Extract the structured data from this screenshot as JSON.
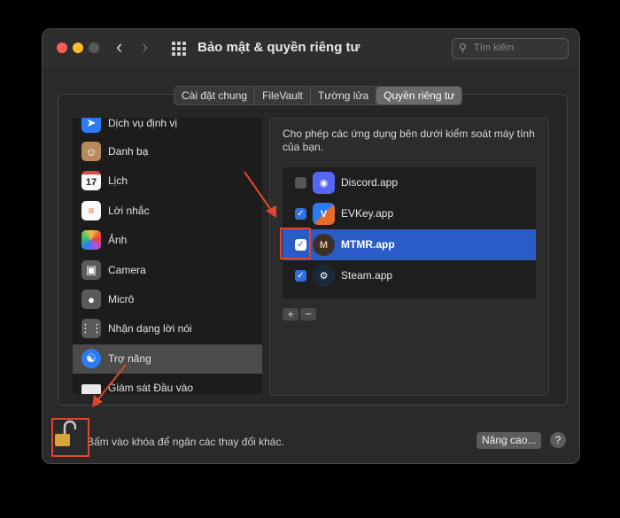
{
  "window": {
    "title": "Bảo mật & quyền riêng tư",
    "search_placeholder": "Tìm kiếm",
    "nav_back": "‹",
    "nav_forward": "›"
  },
  "tabs": [
    {
      "label": "Cài đặt chung"
    },
    {
      "label": "FileVault"
    },
    {
      "label": "Tường lửa"
    },
    {
      "label": "Quyền riêng tư",
      "selected": true
    }
  ],
  "sidebar": {
    "items": [
      {
        "label": "Dịch vụ định vị",
        "icon": "location-icon"
      },
      {
        "label": "Danh bạ",
        "icon": "contacts-icon"
      },
      {
        "label": "Lịch",
        "icon": "calendar-icon",
        "icon_text": "17"
      },
      {
        "label": "Lời nhắc",
        "icon": "reminders-icon"
      },
      {
        "label": "Ảnh",
        "icon": "photos-icon"
      },
      {
        "label": "Camera",
        "icon": "camera-icon"
      },
      {
        "label": "Micrô",
        "icon": "microphone-icon"
      },
      {
        "label": "Nhận dạng lời nói",
        "icon": "speech-recognition-icon"
      },
      {
        "label": "Trợ năng",
        "icon": "accessibility-icon",
        "selected": true
      },
      {
        "label": "Giám sát Đầu vào",
        "icon": "keyboard-icon"
      }
    ]
  },
  "panel": {
    "description": "Cho phép các ứng dụng bên dưới kiểm soát máy tính của bạn.",
    "apps": [
      {
        "name": "Discord.app",
        "checked": false,
        "icon": "discord-icon"
      },
      {
        "name": "EVKey.app",
        "checked": true,
        "icon": "evkey-icon"
      },
      {
        "name": "MTMR.app",
        "checked": true,
        "selected": true,
        "icon": "mtmr-icon",
        "icon_text": "M"
      },
      {
        "name": "Steam.app",
        "checked": true,
        "icon": "steam-icon"
      }
    ],
    "add_label": "+",
    "remove_label": "−"
  },
  "footer": {
    "lock_text": "Bấm vào khóa để ngăn các thay đổi khác.",
    "advanced_label": "Nâng cao...",
    "help_label": "?"
  },
  "colors": {
    "accent": "#2a5cc7",
    "annotation": "#e0462f"
  }
}
